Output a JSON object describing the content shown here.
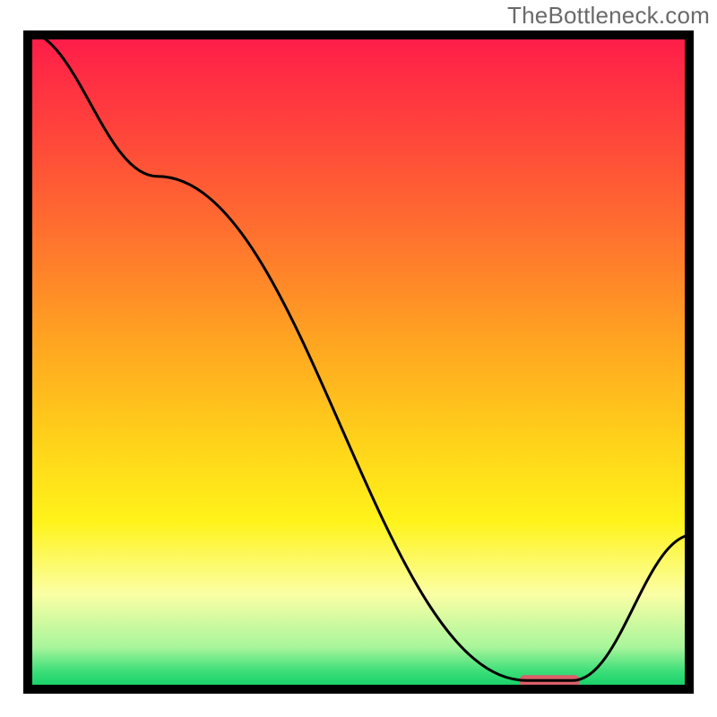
{
  "watermark": "TheBottleneck.com",
  "chart_data": {
    "type": "line",
    "title": "",
    "xlabel": "",
    "ylabel": "",
    "xlim": [
      0,
      100
    ],
    "ylim": [
      0,
      100
    ],
    "x": [
      0,
      20,
      75,
      82,
      100
    ],
    "values": [
      100,
      78,
      2,
      2,
      24
    ],
    "marker": {
      "x_start": 74,
      "x_end": 83,
      "y": 2
    },
    "grid": false,
    "legend": false,
    "background_gradient": {
      "stops": [
        {
          "offset": 0.0,
          "color": "#ff1a4b"
        },
        {
          "offset": 0.12,
          "color": "#ff3b3e"
        },
        {
          "offset": 0.3,
          "color": "#ff6f2f"
        },
        {
          "offset": 0.48,
          "color": "#ffa820"
        },
        {
          "offset": 0.62,
          "color": "#ffd21a"
        },
        {
          "offset": 0.74,
          "color": "#fff31a"
        },
        {
          "offset": 0.85,
          "color": "#fbffa5"
        },
        {
          "offset": 0.93,
          "color": "#a8f59b"
        },
        {
          "offset": 0.965,
          "color": "#3fdf7a"
        },
        {
          "offset": 1.0,
          "color": "#00c95e"
        }
      ]
    },
    "marker_color": "#d9606a",
    "curve_color": "#000000"
  }
}
